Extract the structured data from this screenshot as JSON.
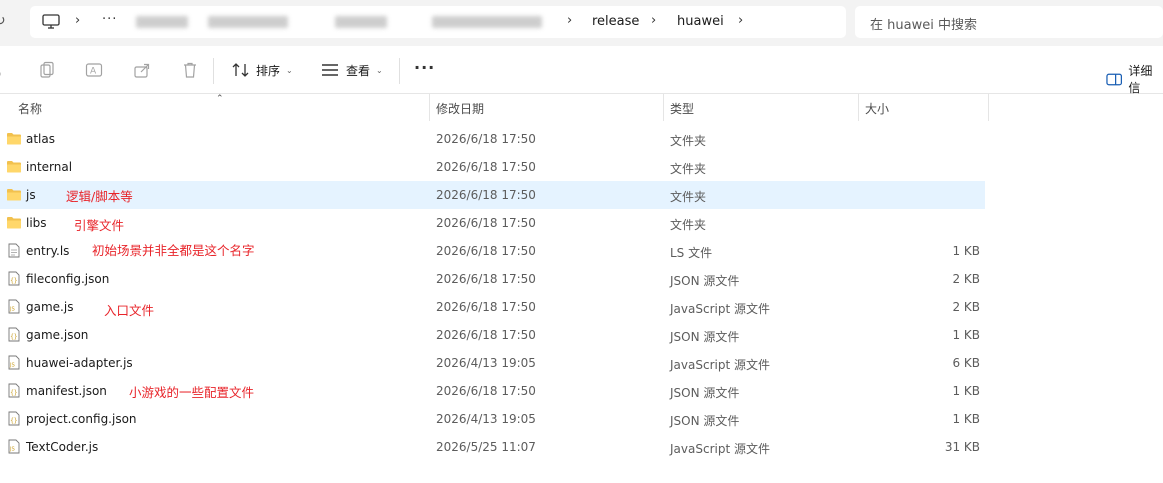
{
  "breadcrumb": {
    "more": "···",
    "items": [
      "release",
      "huawei"
    ]
  },
  "search": {
    "placeholder": "在 huawei 中搜索"
  },
  "toolbar": {
    "sort_label": "排序",
    "view_label": "查看",
    "more_label": "···",
    "details_label": "详细信"
  },
  "columns": {
    "name": "名称",
    "modified": "修改日期",
    "type": "类型",
    "size": "大小"
  },
  "files": [
    {
      "name": "atlas",
      "date": "2026/6/18 17:50",
      "type": "文件夹",
      "size": "",
      "icon": "folder-icon"
    },
    {
      "name": "internal",
      "date": "2026/6/18 17:50",
      "type": "文件夹",
      "size": "",
      "icon": "folder-icon"
    },
    {
      "name": "js",
      "date": "2026/6/18 17:50",
      "type": "文件夹",
      "size": "",
      "icon": "folder-icon"
    },
    {
      "name": "libs",
      "date": "2026/6/18 17:50",
      "type": "文件夹",
      "size": "",
      "icon": "folder-icon"
    },
    {
      "name": "entry.ls",
      "date": "2026/6/18 17:50",
      "type": "LS 文件",
      "size": "1 KB",
      "icon": "file-icon"
    },
    {
      "name": "fileconfig.json",
      "date": "2026/6/18 17:50",
      "type": "JSON 源文件",
      "size": "2 KB",
      "icon": "json-file-icon"
    },
    {
      "name": "game.js",
      "date": "2026/6/18 17:50",
      "type": "JavaScript 源文件",
      "size": "2 KB",
      "icon": "js-file-icon"
    },
    {
      "name": "game.json",
      "date": "2026/6/18 17:50",
      "type": "JSON 源文件",
      "size": "1 KB",
      "icon": "json-file-icon"
    },
    {
      "name": "huawei-adapter.js",
      "date": "2026/4/13 19:05",
      "type": "JavaScript 源文件",
      "size": "6 KB",
      "icon": "js-file-icon"
    },
    {
      "name": "manifest.json",
      "date": "2026/6/18 17:50",
      "type": "JSON 源文件",
      "size": "1 KB",
      "icon": "json-file-icon"
    },
    {
      "name": "project.config.json",
      "date": "2026/4/13 19:05",
      "type": "JSON 源文件",
      "size": "1 KB",
      "icon": "json-file-icon"
    },
    {
      "name": "TextCoder.js",
      "date": "2026/5/25 11:07",
      "type": "JavaScript 源文件",
      "size": "31 KB",
      "icon": "js-file-icon"
    }
  ],
  "annotations": {
    "js": "逻辑/脚本等",
    "libs": "引擎文件",
    "entry": "初始场景并非全都是这个名字",
    "game": "入口文件",
    "manifest": "小游戏的一些配置文件"
  },
  "colors": {
    "selection": "#e5f3ff",
    "annotation": "#e8242a",
    "folder": "#f2c14e"
  }
}
